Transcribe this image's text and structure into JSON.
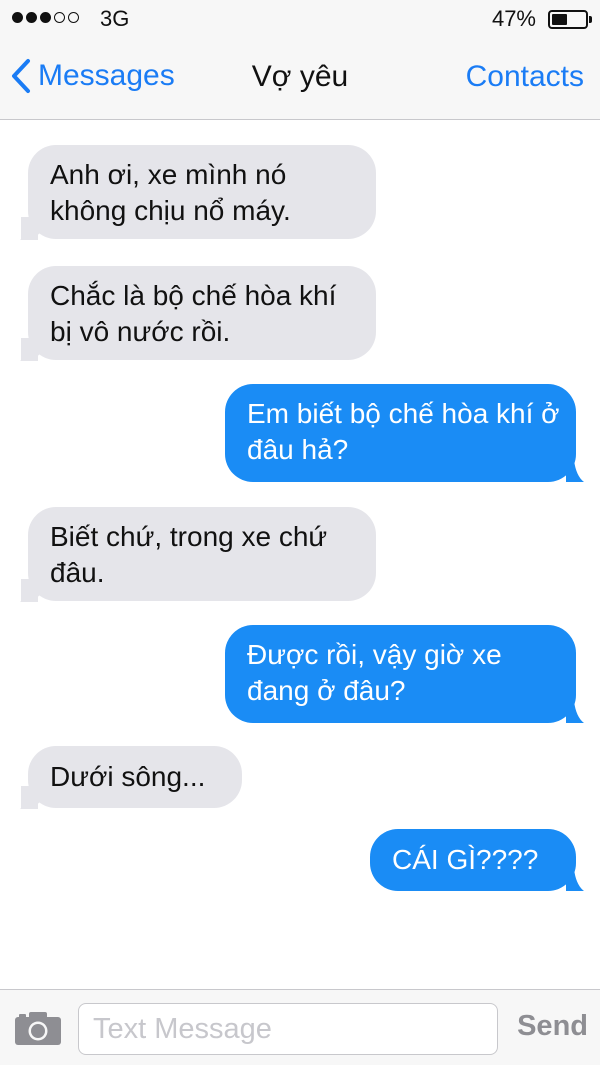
{
  "status_bar": {
    "signal_bars_filled": 3,
    "signal_bars_total": 5,
    "carrier": "3G",
    "battery_percent": "47%",
    "battery_level": 0.47
  },
  "nav": {
    "back_label": "Messages",
    "title": "Vợ yêu",
    "contacts_label": "Contacts"
  },
  "messages": [
    {
      "direction": "incoming",
      "text": "Anh ơi, xe mình nó không chịu nổ máy."
    },
    {
      "direction": "incoming",
      "text": "Chắc là bộ chế hòa khí bị vô nước rồi."
    },
    {
      "direction": "outgoing",
      "text": "Em biết bộ chế hòa khí ở đâu hả?"
    },
    {
      "direction": "incoming",
      "text": "Biết chứ, trong xe chứ đâu."
    },
    {
      "direction": "outgoing",
      "text": "Được rồi, vậy giờ xe đang ở đâu?"
    },
    {
      "direction": "incoming",
      "text": "Dưới sông..."
    },
    {
      "direction": "outgoing",
      "text": "CÁI GÌ????"
    }
  ],
  "input_bar": {
    "camera_icon": "camera-icon",
    "placeholder": "Text Message",
    "send_label": "Send"
  },
  "colors": {
    "accent": "#1a7cf5",
    "incoming_bubble": "#e5e5ea",
    "outgoing_bubble": "#1a8cf5"
  }
}
